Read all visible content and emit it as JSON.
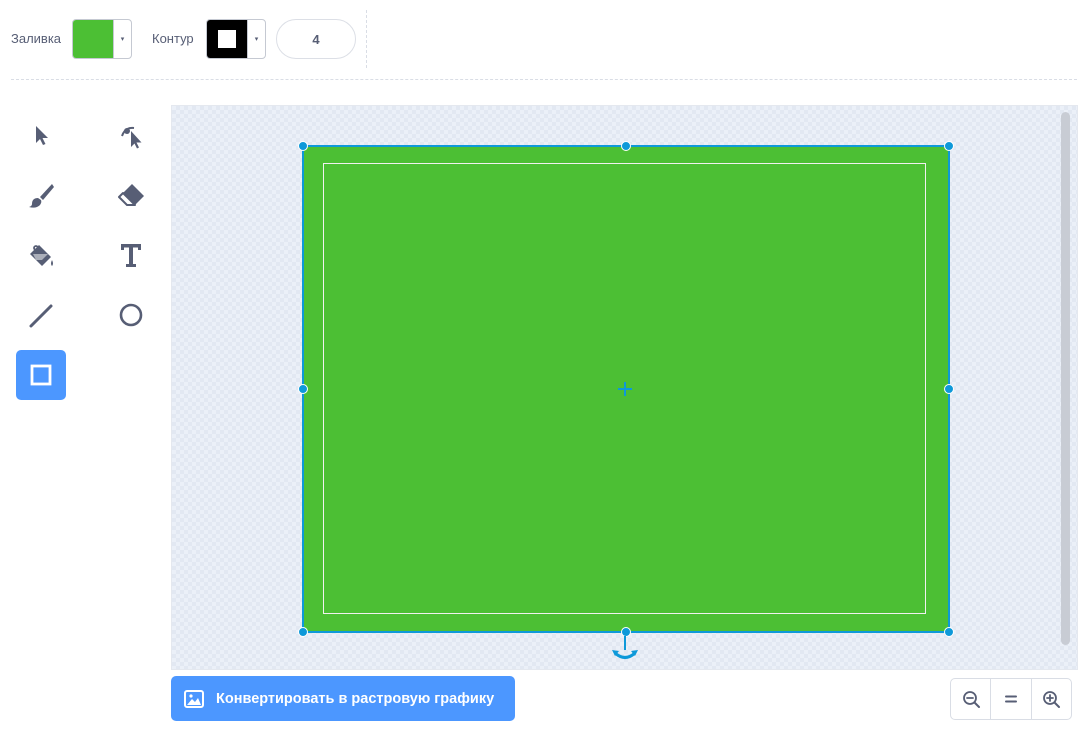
{
  "toolbar": {
    "fill_label": "Заливка",
    "fill_color": "#4cbf34",
    "outline_label": "Контур",
    "outline_color": "#000000",
    "outline_width": "4",
    "dropdown_arrow": "▾"
  },
  "tools": [
    {
      "name": "select-tool",
      "icon": "arrow-pointer-icon",
      "selected": false
    },
    {
      "name": "reshape-tool",
      "icon": "reshape-icon",
      "selected": false
    },
    {
      "name": "brush-tool",
      "icon": "brush-icon",
      "selected": false
    },
    {
      "name": "eraser-tool",
      "icon": "eraser-icon",
      "selected": false
    },
    {
      "name": "fill-tool",
      "icon": "paint-bucket-icon",
      "selected": false
    },
    {
      "name": "text-tool",
      "icon": "text-icon",
      "selected": false
    },
    {
      "name": "line-tool",
      "icon": "line-icon",
      "selected": false
    },
    {
      "name": "circle-tool",
      "icon": "circle-icon",
      "selected": false
    },
    {
      "name": "rectangle-tool",
      "icon": "rectangle-icon",
      "selected": true
    }
  ],
  "colors": {
    "accent": "#4c97ff",
    "selection": "#0e99d9",
    "shape_fill": "#4cbf34",
    "icon": "#575e75"
  },
  "bottom": {
    "convert_label": "Конвертировать в растровую графику",
    "convert_icon": "image-icon",
    "zoom_out_icon": "zoom-out-icon",
    "zoom_reset_icon": "zoom-reset-icon",
    "zoom_in_icon": "zoom-in-icon"
  }
}
